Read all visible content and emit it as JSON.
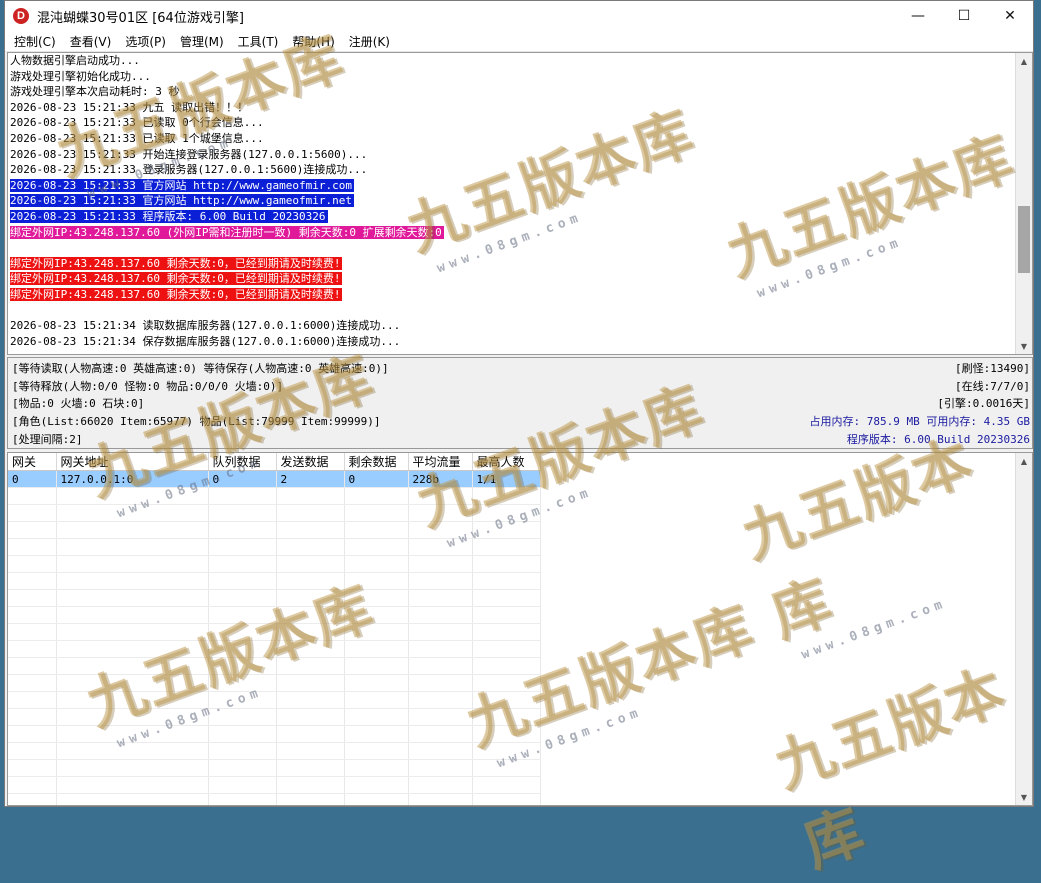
{
  "window": {
    "app_icon_glyph": "D",
    "title": "混沌蝴蝶30号01区 [64位游戏引擎]",
    "minimize_glyph": "—",
    "maximize_glyph": "☐",
    "close_glyph": "✕"
  },
  "menu": [
    "控制(C)",
    "查看(V)",
    "选项(P)",
    "管理(M)",
    "工具(T)",
    "帮助(H)",
    "注册(K)"
  ],
  "log": [
    {
      "text": "人物数据引擎启动成功...",
      "style": ""
    },
    {
      "text": "游戏处理引擎初始化成功...",
      "style": ""
    },
    {
      "text": "游戏处理引擎本次启动耗时: 3 秒",
      "style": ""
    },
    {
      "text": "2026-08-23 15:21:33 九五 读取出错！！！",
      "style": ""
    },
    {
      "text": "2026-08-23 15:21:33 已读取 0个行会信息...",
      "style": ""
    },
    {
      "text": "2026-08-23 15:21:33 已读取 1个城堡信息...",
      "style": ""
    },
    {
      "text": "2026-08-23 15:21:33 开始连接登录服务器(127.0.0.1:5600)...",
      "style": ""
    },
    {
      "text": "2026-08-23 15:21:33 登录服务器(127.0.0.1:5600)连接成功...",
      "style": ""
    },
    {
      "text": "2026-08-23 15:21:33 官方网站 http://www.gameofmir.com",
      "style": "hl-blue"
    },
    {
      "text": "2026-08-23 15:21:33 官方网站 http://www.gameofmir.net",
      "style": "hl-blue"
    },
    {
      "text": "2026-08-23 15:21:33 程序版本: 6.00 Build 20230326",
      "style": "hl-blue"
    },
    {
      "text": "绑定外网IP:43.248.137.60 (外网IP需和注册时一致) 剩余天数:0 扩展剩余天数:0",
      "style": "hl-pink"
    },
    {
      "text": "",
      "style": ""
    },
    {
      "text": "绑定外网IP:43.248.137.60 剩余天数:0，已经到期请及时续费!",
      "style": "hl-red"
    },
    {
      "text": "绑定外网IP:43.248.137.60 剩余天数:0，已经到期请及时续费!",
      "style": "hl-red"
    },
    {
      "text": "绑定外网IP:43.248.137.60 剩余天数:0，已经到期请及时续费!",
      "style": "hl-red"
    },
    {
      "text": "",
      "style": ""
    },
    {
      "text": "2026-08-23 15:21:34 读取数据库服务器(127.0.0.1:6000)连接成功...",
      "style": ""
    },
    {
      "text": "2026-08-23 15:21:34 保存数据库服务器(127.0.0.1:6000)连接成功...",
      "style": ""
    }
  ],
  "log_scroll": {
    "up": "▲",
    "down": "▼",
    "thumb_position": 0.68,
    "thumb_fraction": 0.25
  },
  "status": {
    "line1_left": "[等待读取(人物高速:0 英雄高速:0) 等待保存(人物高速:0 英雄高速:0)]",
    "line2_left": "[等待释放(人物:0/0 怪物:0 物品:0/0/0 火墙:0)]",
    "line3_left": "[物品:0 火墙:0 石块:0]",
    "line4_left": "[角色(List:66020 Item:65977) 物品(List:79999 Item:99999)]",
    "line5_left": "[处理间隔:2]",
    "line1_right": "[刷怪:13490]",
    "line2_right": "[在线:7/7/0]",
    "line3_right": "[引擎:0.0016天]",
    "memory": "占用内存: 785.9 MB 可用内存: 4.35 GB",
    "version": "程序版本: 6.00 Build 20230326"
  },
  "grid": {
    "columns": [
      "网关",
      "网关地址",
      "队列数据",
      "发送数据",
      "剩余数据",
      "平均流量",
      "最高人数"
    ],
    "rows": [
      [
        "0",
        "127.0.0.1:0",
        "0",
        "2",
        "0",
        "228b",
        "1/1"
      ]
    ],
    "scroll_up": "▲",
    "scroll_down": "▼"
  },
  "watermark": {
    "brand": "九五版本库",
    "url": "www.08gm.com"
  }
}
